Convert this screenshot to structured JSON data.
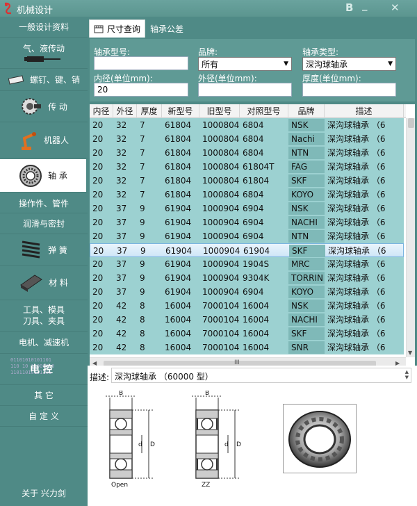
{
  "window": {
    "title": "机械设计",
    "extra_button": "B"
  },
  "sidebar": {
    "items": [
      {
        "label": "一般设计资料"
      },
      {
        "label": "气、液传动"
      },
      {
        "label": "螺钉、键、销"
      },
      {
        "label": "传 动"
      },
      {
        "label": "机器人"
      },
      {
        "label": "轴 承"
      },
      {
        "label": "操作件、管件"
      },
      {
        "label": "润滑与密封"
      },
      {
        "label": "弹 簧"
      },
      {
        "label": "材 料"
      },
      {
        "label_line1": "工具、模具",
        "label_line2": "刀具、夹具"
      },
      {
        "label": "电机、减速机"
      },
      {
        "label": "电 控",
        "binary1": "01101010101101",
        "binary2": "110 10 11000010",
        "binary3": "11011010101101"
      },
      {
        "label": "其 它"
      },
      {
        "label": "自 定 义"
      },
      {
        "label": "关于 兴力剑"
      }
    ]
  },
  "tabs": [
    {
      "label": "尺寸查询"
    },
    {
      "label": "轴承公差"
    }
  ],
  "form": {
    "model_label": "轴承型号:",
    "model_value": "",
    "brand_label": "品牌:",
    "brand_value": "所有",
    "type_label": "轴承类型:",
    "type_value": "深沟球轴承",
    "inner_label": "内径(单位mm):",
    "inner_value": "20",
    "outer_label": "外径(单位mm):",
    "outer_value": "",
    "thick_label": "厚度(单位mm):",
    "thick_value": ""
  },
  "table": {
    "columns": [
      "内径",
      "外径",
      "厚度",
      "新型号",
      "旧型号",
      "对照型号",
      "品牌",
      "描述"
    ],
    "rows": [
      [
        "20",
        "32",
        "7",
        "61804",
        "1000804",
        "6804",
        "NSK",
        "深沟球轴承 （6"
      ],
      [
        "20",
        "32",
        "7",
        "61804",
        "1000804",
        "6804",
        "Nachi",
        "深沟球轴承 （6"
      ],
      [
        "20",
        "32",
        "7",
        "61804",
        "1000804",
        "6804",
        "NTN",
        "深沟球轴承 （6"
      ],
      [
        "20",
        "32",
        "7",
        "61804",
        "1000804",
        "61804T",
        "FAG",
        "深沟球轴承 （6"
      ],
      [
        "20",
        "32",
        "7",
        "61804",
        "1000804",
        "61804",
        "SKF",
        "深沟球轴承 （6"
      ],
      [
        "20",
        "32",
        "7",
        "61804",
        "1000804",
        "6804",
        "KOYO",
        "深沟球轴承 （6"
      ],
      [
        "20",
        "37",
        "9",
        "61904",
        "1000904",
        "6904",
        "NSK",
        "深沟球轴承 （6"
      ],
      [
        "20",
        "37",
        "9",
        "61904",
        "1000904",
        "6904",
        "NACHI",
        "深沟球轴承 （6"
      ],
      [
        "20",
        "37",
        "9",
        "61904",
        "1000904",
        "6904",
        "NTN",
        "深沟球轴承 （6"
      ],
      [
        "20",
        "37",
        "9",
        "61904",
        "1000904",
        "61904",
        "SKF",
        "深沟球轴承 （6"
      ],
      [
        "20",
        "37",
        "9",
        "61904",
        "1000904",
        "1904S",
        "MRC",
        "深沟球轴承 （6"
      ],
      [
        "20",
        "37",
        "9",
        "61904",
        "1000904",
        "9304K",
        "TORRIN",
        "深沟球轴承 （6"
      ],
      [
        "20",
        "37",
        "9",
        "61904",
        "1000904",
        "6904",
        "KOYO",
        "深沟球轴承 （6"
      ],
      [
        "20",
        "42",
        "8",
        "16004",
        "7000104",
        "16004",
        "NSK",
        "深沟球轴承 （6"
      ],
      [
        "20",
        "42",
        "8",
        "16004",
        "7000104",
        "16004",
        "NACHI",
        "深沟球轴承 （6"
      ],
      [
        "20",
        "42",
        "8",
        "16004",
        "7000104",
        "16004",
        "SKF",
        "深沟球轴承 （6"
      ],
      [
        "20",
        "42",
        "8",
        "16004",
        "7000104",
        "16004",
        "SNR",
        "深沟球轴承 （6"
      ]
    ],
    "selected_row": 9
  },
  "description": {
    "label": "描述:",
    "value": "深沟球轴承 （60000 型）",
    "diagram_open_caption": "Open",
    "diagram_zz_caption": "ZZ",
    "dim_b": "B",
    "dim_d_inner": "d",
    "dim_d_outer": "D"
  },
  "colors": {
    "background": "#4f8a86",
    "row": "#9cd1d1",
    "brand_cell": "#7fb9b8",
    "selected_row": "#cfe6f7"
  }
}
